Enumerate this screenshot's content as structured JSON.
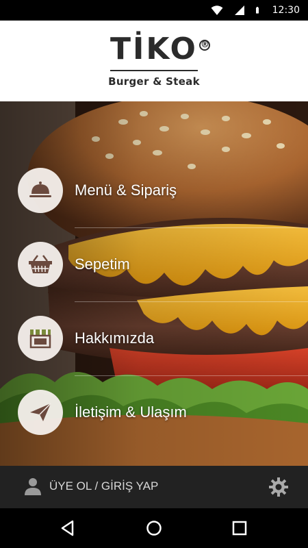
{
  "status_bar": {
    "time": "12:30",
    "icons": [
      "wifi-icon",
      "cell-signal-icon",
      "battery-icon"
    ]
  },
  "header": {
    "logo_text": "TİKO",
    "logo_mark": "®",
    "logo_subtitle": "Burger & Steak"
  },
  "menu": {
    "items": [
      {
        "label": "Menü & Sipariş",
        "icon": "cloche-icon"
      },
      {
        "label": "Sepetim",
        "icon": "basket-icon"
      },
      {
        "label": "Hakkımızda",
        "icon": "storefront-icon"
      },
      {
        "label": "İletişim & Ulaşım",
        "icon": "paper-plane-icon"
      }
    ]
  },
  "bottom_bar": {
    "login_label": "ÜYE OL / GİRİŞ YAP",
    "settings_icon": "gear-icon"
  },
  "nav_bar": {
    "icons": [
      "back-icon",
      "home-icon",
      "recents-icon"
    ]
  },
  "colors": {
    "header_bg": "#ffffff",
    "logo": "#2b2b2b",
    "bottom_bar": "#222222",
    "circle_bg": "#f5f0ec",
    "icon_brown": "#6b4a3e",
    "icon_green": "#7a8a3a"
  }
}
